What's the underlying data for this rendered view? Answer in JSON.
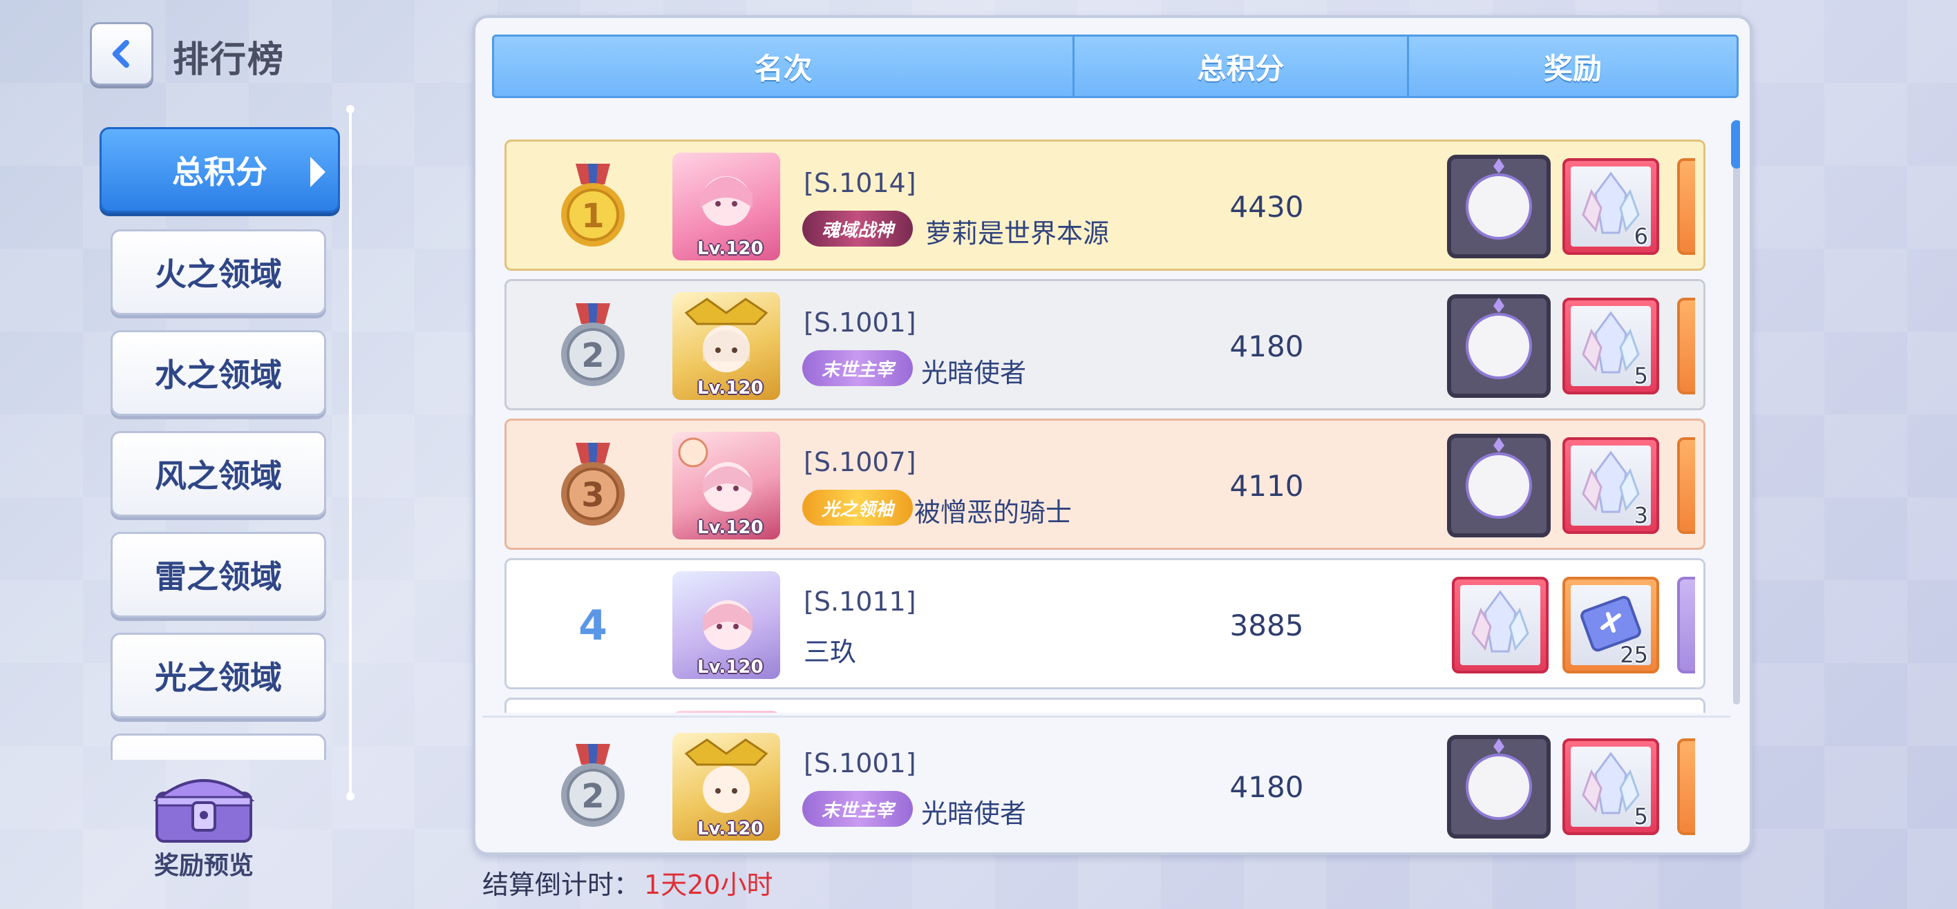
{
  "header": {
    "title": "排行榜"
  },
  "sidebar": {
    "items": [
      {
        "label": "总积分",
        "active": true
      },
      {
        "label": "火之领域"
      },
      {
        "label": "水之领域"
      },
      {
        "label": "风之领域"
      },
      {
        "label": "雷之领域"
      },
      {
        "label": "光之领域"
      }
    ],
    "reward_preview_label": "奖励预览"
  },
  "table": {
    "columns": [
      "名次",
      "总积分",
      "奖励"
    ],
    "rows": [
      {
        "rank": "1",
        "medal": "gold",
        "server": "[S.1014]",
        "title_badge": "魂域战神",
        "name": "萝莉是世界本源",
        "level": "Lv.120",
        "score": "4430",
        "reward_count": "6"
      },
      {
        "rank": "2",
        "medal": "silver",
        "server": "[S.1001]",
        "title_badge": "末世主宰",
        "name": "光暗使者",
        "level": "Lv.120",
        "score": "4180",
        "reward_count": "5"
      },
      {
        "rank": "3",
        "medal": "bronze",
        "server": "[S.1007]",
        "title_badge": "光之领袖",
        "name": "被憎恶的骑士",
        "level": "Lv.120",
        "score": "4110",
        "reward_count": "3"
      },
      {
        "rank": "4",
        "medal": "none",
        "server": "[S.1011]",
        "title_badge": "",
        "name": "三玖",
        "level": "Lv.120",
        "score": "3885",
        "reward_count": "25"
      }
    ],
    "my_row": {
      "rank": "2",
      "medal": "silver",
      "server": "[S.1001]",
      "title_badge": "末世主宰",
      "name": "光暗使者",
      "level": "Lv.120",
      "score": "4180",
      "reward_count": "5"
    }
  },
  "footer": {
    "countdown_label": "结算倒计时：",
    "countdown_value": "1天20小时"
  },
  "colors": {
    "accent_blue": "#2b7fe6",
    "header_blue": "#71b7fb",
    "countdown_red": "#e02e36",
    "gold_row": "#fdf1c8",
    "silver_row": "#eeeff2",
    "bronze_row": "#fde9dc"
  },
  "icons": [
    "back-arrow-icon",
    "chevron-right-icon",
    "treasure-chest-icon",
    "gold-medal-icon",
    "silver-medal-icon",
    "bronze-medal-icon",
    "avatar-frame-icon",
    "crystal-icon",
    "ticket-icon"
  ]
}
